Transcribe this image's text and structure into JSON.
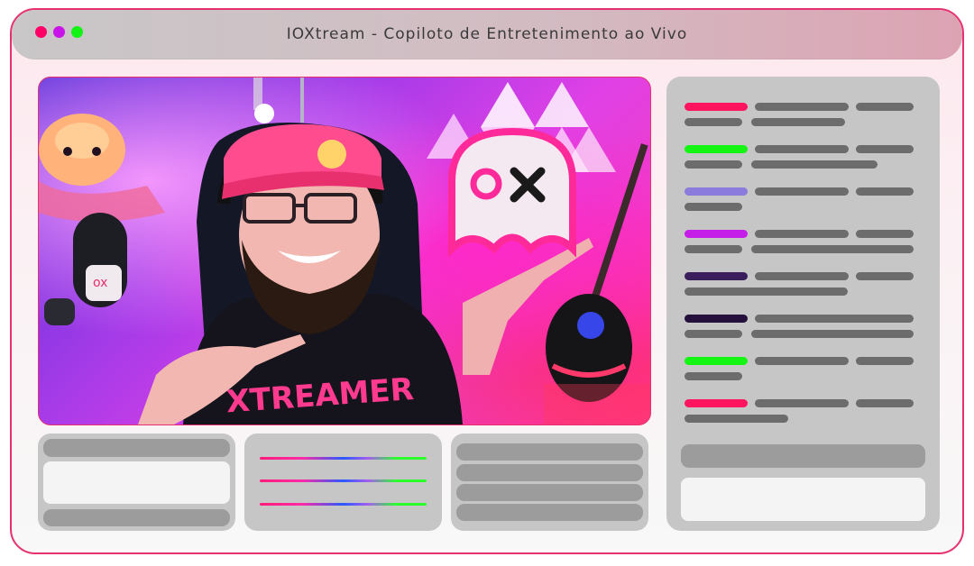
{
  "window": {
    "title": "IOXtream - Copiloto de Entretenimento ao Vivo",
    "traffic_lights": [
      "close",
      "minimize",
      "maximize"
    ]
  },
  "colors": {
    "accent_border": "#e6306f",
    "dot_red": "#ff0066",
    "dot_purple": "#c814e8",
    "dot_green": "#13f215",
    "panel_gray": "#c6c6c6",
    "bar_gray": "#9c9c9c",
    "chat_text_gray": "#6c6c6c"
  },
  "video": {
    "description_icon": "webcam-stream-feed",
    "shirt_text": "XTREAMER",
    "logo_text": "OX"
  },
  "chat": {
    "messages": [
      {
        "color": "#ff1460"
      },
      {
        "color": "#14f514"
      },
      {
        "color": "#8a7bdc"
      },
      {
        "color": "#c51ee8"
      },
      {
        "color": "#3a1f5c"
      },
      {
        "color": "#24103a"
      },
      {
        "color": "#14f514"
      },
      {
        "color": "#ff1460"
      }
    ]
  }
}
